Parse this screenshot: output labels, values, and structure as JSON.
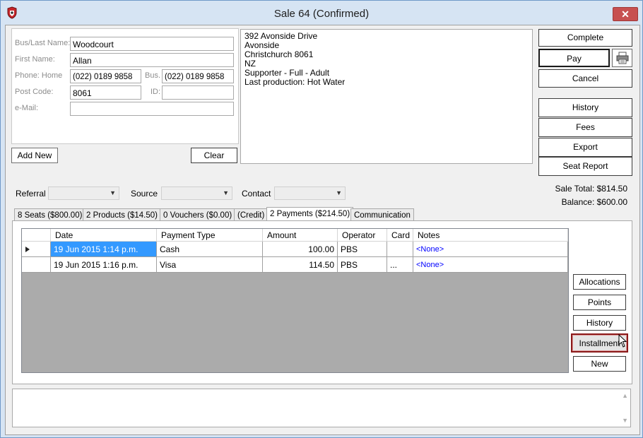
{
  "window": {
    "title": "Sale 64 (Confirmed)",
    "close_label": "✕"
  },
  "customer": {
    "labels": {
      "last_name": "Bus/Last Name:",
      "first_name": "First Name:",
      "phone_home": "Phone: Home",
      "phone_bus": "Bus.",
      "post_code": "Post Code:",
      "id": "ID:",
      "email": "e-Mail:"
    },
    "values": {
      "last_name": "Woodcourt",
      "first_name": "Allan",
      "phone_home": "(022) 0189 9858",
      "phone_bus": "(022) 0189 9858",
      "post_code": "8061",
      "id": "",
      "email": ""
    },
    "add_new_label": "Add New",
    "clear_label": "Clear"
  },
  "address": [
    "392 Avonside Drive",
    "Avonside",
    "Christchurch 8061",
    "NZ",
    "Supporter - Full - Adult",
    "Last production: Hot Water"
  ],
  "actions": {
    "complete": "Complete",
    "pay": "Pay",
    "cancel": "Cancel",
    "history": "History",
    "fees": "Fees",
    "export": "Export",
    "seat_report": "Seat Report"
  },
  "filters": {
    "referral": "Referral",
    "source": "Source",
    "contact": "Contact",
    "referral_value": "",
    "source_value": "",
    "contact_value": ""
  },
  "totals": {
    "sale_total": "Sale Total: $814.50",
    "balance": "Balance: $600.00"
  },
  "tabs": [
    "8 Seats ($800.00)",
    "2 Products ($14.50)",
    "0 Vouchers ($0.00)",
    "(Credit)",
    "2 Payments ($214.50)",
    "Communication"
  ],
  "payments": {
    "columns": [
      "Date",
      "Payment Type",
      "Amount",
      "Operator",
      "Card",
      "Notes"
    ],
    "rows": [
      {
        "date": "19 Jun 2015 1:14 p.m.",
        "type": "Cash",
        "amount": "100.00",
        "operator": "PBS",
        "card": "",
        "notes": "<None>"
      },
      {
        "date": "19 Jun 2015 1:16 p.m.",
        "type": "Visa",
        "amount": "114.50",
        "operator": "PBS",
        "card": "...",
        "notes": "<None>"
      }
    ]
  },
  "payment_buttons": {
    "allocations": "Allocations",
    "points": "Points",
    "history": "History",
    "installments": "Installment",
    "new": "New"
  },
  "colors": {
    "accent_border": "#8b1a1a",
    "selection": "#3399ff",
    "grid_background": "#ababab",
    "close": "#c75050"
  },
  "icons": {
    "app": "shield-logo-icon",
    "printer": "printer-icon",
    "row_indicator": "row-pointer-icon",
    "cursor": "mouse-pointer-icon"
  }
}
